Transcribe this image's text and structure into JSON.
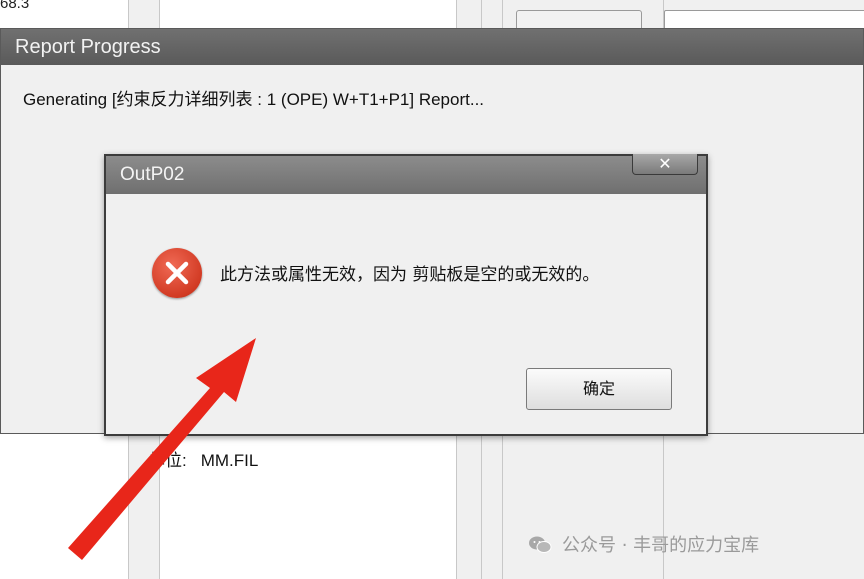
{
  "background": {
    "top_text": "68.3",
    "unit_label": "单位:",
    "unit_value": "MM.FIL"
  },
  "report_window": {
    "title": "Report Progress",
    "message": "Generating [约束反力详细列表 : 1 (OPE) W+T1+P1] Report..."
  },
  "dialog": {
    "title": "OutP02",
    "close_glyph": "✕",
    "icon": "error-icon",
    "message": "此方法或属性无效，因为 剪贴板是空的或无效的。",
    "ok_label": "确定"
  },
  "watermark": {
    "icon": "wechat-icon",
    "text": "公众号 · 丰哥的应力宝库"
  },
  "colors": {
    "error_red": "#d23b24",
    "arrow_red": "#e8261a",
    "titlebar_gray": "#6f6f6f"
  }
}
